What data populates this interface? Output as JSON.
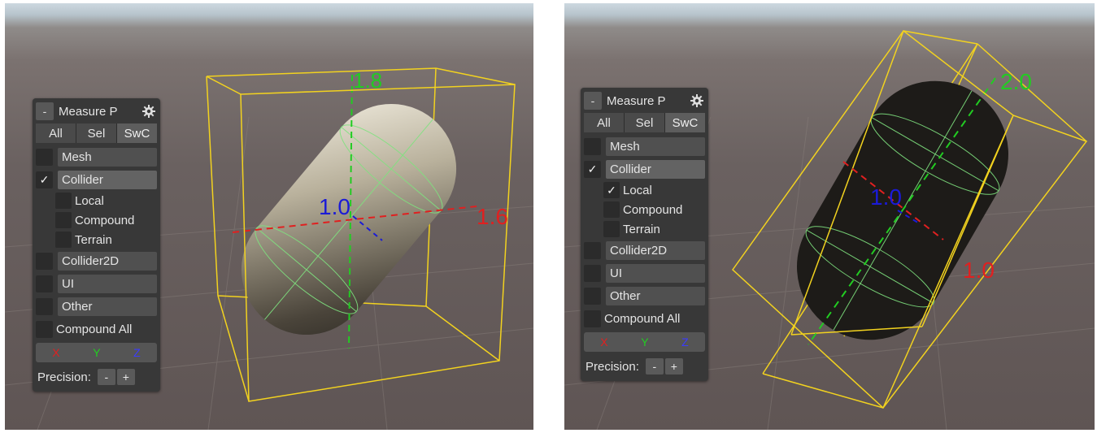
{
  "views": [
    {
      "panel": {
        "collapse_label": "-",
        "title": "Measure P",
        "tabs": [
          "All",
          "Sel",
          "SwC"
        ],
        "rows": [
          {
            "label": "Mesh",
            "checked": false
          },
          {
            "label": "Collider",
            "checked": true
          },
          {
            "label": "Local",
            "checked": false
          },
          {
            "label": "Compound",
            "checked": false
          },
          {
            "label": "Terrain",
            "checked": false
          },
          {
            "label": "Collider2D",
            "checked": false
          },
          {
            "label": "UI",
            "checked": false
          },
          {
            "label": "Other",
            "checked": false
          },
          {
            "label": "Compound All",
            "checked": false
          }
        ],
        "axes": [
          "X",
          "Y",
          "Z"
        ],
        "precision_label": "Precision:",
        "minus": "-",
        "plus": "+"
      },
      "measurements": {
        "y": "1.8",
        "z": "1.0",
        "x": "1.6"
      }
    },
    {
      "panel": {
        "collapse_label": "-",
        "title": "Measure P",
        "tabs": [
          "All",
          "Sel",
          "SwC"
        ],
        "rows": [
          {
            "label": "Mesh",
            "checked": false
          },
          {
            "label": "Collider",
            "checked": true
          },
          {
            "label": "Local",
            "checked": true
          },
          {
            "label": "Compound",
            "checked": false
          },
          {
            "label": "Terrain",
            "checked": false
          },
          {
            "label": "Collider2D",
            "checked": false
          },
          {
            "label": "UI",
            "checked": false
          },
          {
            "label": "Other",
            "checked": false
          },
          {
            "label": "Compound All",
            "checked": false
          }
        ],
        "axes": [
          "X",
          "Y",
          "Z"
        ],
        "precision_label": "Precision:",
        "minus": "-",
        "plus": "+"
      },
      "measurements": {
        "y": "2.0",
        "z": "1.0",
        "x": "1.0"
      }
    }
  ],
  "colors": {
    "bounds": "#f2d21f",
    "axis_x": "#e02020",
    "axis_y": "#22cc22",
    "axis_z": "#1b1bd6",
    "panel_bg": "#383838"
  },
  "checkmark": "✓",
  "icons": {
    "settings": "gear-icon",
    "check": "checkmark-icon"
  }
}
